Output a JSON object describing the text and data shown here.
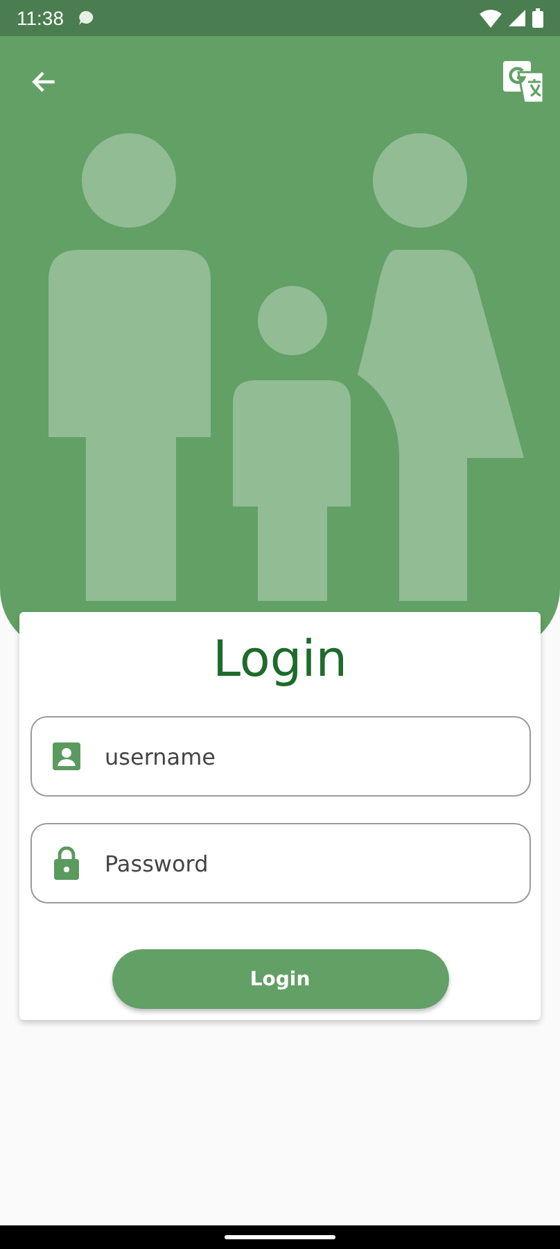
{
  "status_bar": {
    "time": "11:38"
  },
  "login": {
    "title": "Login",
    "fields": [
      {
        "kind": "text",
        "placeholder": "username"
      },
      {
        "kind": "password",
        "placeholder": "Password"
      }
    ],
    "button": "Login"
  }
}
